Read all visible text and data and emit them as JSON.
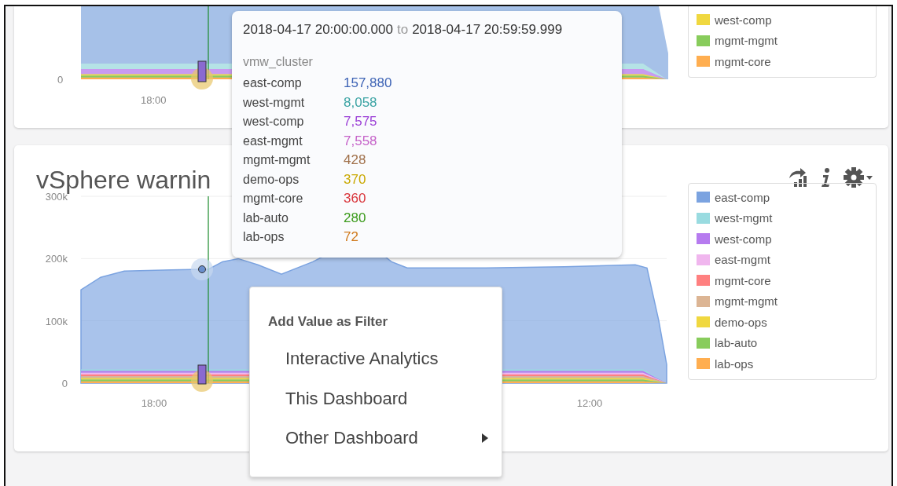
{
  "top_panel": {
    "chart": {
      "y_tick": "0",
      "x_label": "18:00"
    },
    "legend": [
      {
        "label": "west-comp",
        "color": "#f0d840"
      },
      {
        "label": "mgmt-mgmt",
        "color": "#88cc5c"
      },
      {
        "label": "mgmt-core",
        "color": "#ffae50"
      }
    ]
  },
  "panel": {
    "title": "vSphere warnin",
    "chart": {
      "y_ticks": [
        "300k",
        "200k",
        "100k",
        "0"
      ],
      "x_labels": [
        "18:00",
        "12:00"
      ]
    },
    "legend": [
      {
        "label": "east-comp",
        "color": "#7ba3e0"
      },
      {
        "label": "west-mgmt",
        "color": "#99dbe0"
      },
      {
        "label": "west-comp",
        "color": "#b67bef"
      },
      {
        "label": "east-mgmt",
        "color": "#f0b6ee"
      },
      {
        "label": "mgmt-core",
        "color": "#ff8080"
      },
      {
        "label": "mgmt-mgmt",
        "color": "#dcb594"
      },
      {
        "label": "demo-ops",
        "color": "#f0d840"
      },
      {
        "label": "lab-auto",
        "color": "#88cc5c"
      },
      {
        "label": "lab-ops",
        "color": "#ffae50"
      }
    ]
  },
  "tooltip": {
    "range_start": "2018-04-17 20:00:00.000",
    "range_joiner": "to",
    "range_end": "2018-04-17 20:59:59.999",
    "group_label": "vmw_cluster",
    "rows": [
      {
        "name": "east-comp",
        "value": "157,880",
        "color": "#3d63b5"
      },
      {
        "name": "west-mgmt",
        "value": "8,058",
        "color": "#3aa3a3"
      },
      {
        "name": "west-comp",
        "value": "7,575",
        "color": "#9b3fd6"
      },
      {
        "name": "east-mgmt",
        "value": "7,558",
        "color": "#c562c9"
      },
      {
        "name": "mgmt-mgmt",
        "value": "428",
        "color": "#a0704a"
      },
      {
        "name": "demo-ops",
        "value": "370",
        "color": "#c9a800"
      },
      {
        "name": "mgmt-core",
        "value": "360",
        "color": "#d9343a"
      },
      {
        "name": "lab-auto",
        "value": "280",
        "color": "#3a9a1a"
      },
      {
        "name": "lab-ops",
        "value": "72",
        "color": "#d07a1c"
      }
    ]
  },
  "context_menu": {
    "header": "Add Value as Filter",
    "items": [
      {
        "label": "Interactive Analytics",
        "submenu": false
      },
      {
        "label": "This Dashboard",
        "submenu": false
      },
      {
        "label": "Other Dashboard",
        "submenu": true
      }
    ]
  }
}
